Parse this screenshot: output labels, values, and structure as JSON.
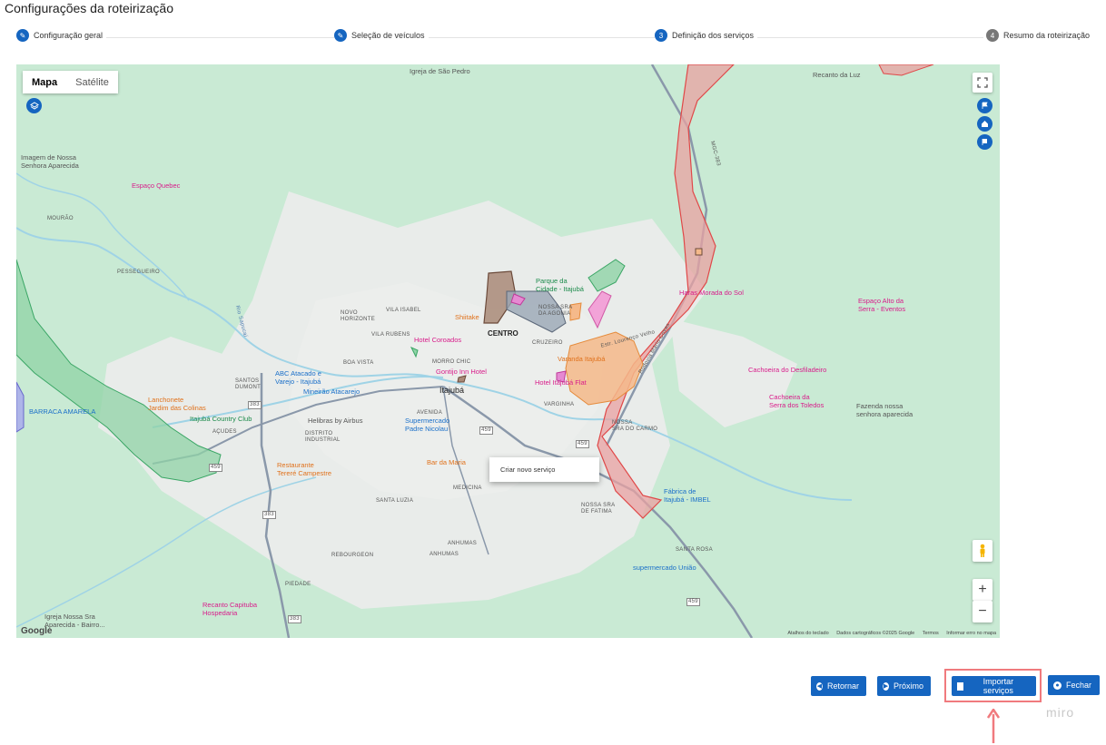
{
  "page": {
    "title": "Configurações da roteirização"
  },
  "stepper": {
    "steps": [
      {
        "number": "",
        "label": "Configuração geral",
        "state": "done"
      },
      {
        "number": "",
        "label": "Seleção de veículos",
        "state": "done"
      },
      {
        "number": "3",
        "label": "Definição dos serviços",
        "state": "active"
      },
      {
        "number": "4",
        "label": "Resumo da roteirização",
        "state": "pending"
      }
    ]
  },
  "map": {
    "type_toggle": {
      "map": "Mapa",
      "satellite": "Satélite",
      "selected": "Mapa"
    },
    "controls": {
      "fullscreen_icon": "fullscreen-icon",
      "zoom_in": "+",
      "zoom_out": "−",
      "street_view_icon": "pegman-icon"
    },
    "places": {
      "igreja_sao_pedro": "Igreja de São Pedro",
      "recanto_luz": "Recanto da Luz",
      "imagem_nossa_senhora": "Imagem de Nossa\nSenhora Aparecida",
      "espaco_quebec": "Espaço Quebec",
      "mourao": "MOURÃO",
      "pessegueiro": "PESSEGUEIRO",
      "parque_cidade": "Parque da\nCidade - Itajubá",
      "haras": "Haras Morada do Sol",
      "espaco_alto": "Espaço Alto da\nSerra - Eventos",
      "novo_horizonte": "NOVO\nHORIZONTE",
      "vila_isabel": "VILA ISABEL",
      "shiitake": "Shiitake",
      "nossa_sra_agonia": "NOSSA SRA\nDA AGONIA",
      "vila_rubens": "VILA RUBENS",
      "centro": "CENTRO",
      "cruzeiro": "CRUZEIRO",
      "hotel_coroados": "Hotel Coroados",
      "varanda": "Varanda Itajubá",
      "cachoeira_desfiladeiro": "Cachoeira do Desfiladeiro",
      "boa_vista": "BOA VISTA",
      "morro_chic": "MORRO CHIC",
      "gontijo": "Gontijo Inn Hotel",
      "hotel_flat": "Hotel Itajubá Flat",
      "santos_dumont": "SANTOS\nDUMONT",
      "abc_atacado": "ABC Atacado e\nVarejo - Itajubá",
      "mineirao": "Mineirão Atacarejo",
      "itajuba": "Itajubá",
      "varginha": "VARGINHA",
      "cachoeira_toledos": "Cachoeira da\nSerra dos Toledos",
      "fazenda": "Fazenda nossa\nsenhora aparecida",
      "lanchonete": "Lanchonete\nJardim das Colinas",
      "barraca": "BARRACA AMARELA",
      "country_club": "Itajubá Country Club",
      "helibras": "Helibras by Airbus",
      "avenida": "AVENIDA",
      "supermercado_nicolau": "Supermercado\nPadre Nicolau",
      "nossa_sra_carmo": "NOSSA\nSRA DO CARMO",
      "acudes": "AÇUDES",
      "distrito": "DISTRITO\nINDUSTRIAL",
      "restaurante": "Restaurante\nTereré Campestre",
      "bar_maria": "Bar da Maria",
      "fabrica": "Fábrica de\nItajubá - IMBEL",
      "santa_luzia": "SANTA LUZIA",
      "medicina": "MEDICINA",
      "nossa_sra_fatima": "NOSSA SRA\nDE FATIMA",
      "anhumas": "ANHUMAS",
      "rebourgeon": "REBOURGEON",
      "anhumas2": "ANHUMAS",
      "santa_rosa": "SANTA ROSA",
      "supermercado_uniao": "supermercado União",
      "piedade": "PIEDADE",
      "recanto_capituba": "Recanto Capituba\nHospedaria",
      "igreja_aparecida": "Igreja Nossa Sra\nAparecida - Bairro...",
      "rio_sapucai": "Rio Sapucaí",
      "rodovia": "Rodovia Mário Covas",
      "mgc383": "MGC-383",
      "estr_lourenco": "Estr. Lourenço Velho"
    },
    "road_shields": [
      "383",
      "459",
      "459",
      "459",
      "459",
      "383",
      "383"
    ],
    "context_menu": {
      "item": "Criar novo serviço"
    },
    "attribution": {
      "shortcuts": "Atalhos do teclado",
      "data": "Dados cartográficos ©2025 Google",
      "terms": "Termos",
      "report": "Informar erro no mapa",
      "logo": "Google"
    },
    "colors": {
      "land": "#e8ece6",
      "vegetation": "#c9ead4",
      "water": "#9fd3e6",
      "zone_red": "#e8a2a2",
      "zone_orange": "#f5b98a",
      "zone_green": "#8fd3a6"
    }
  },
  "actions": {
    "back": "Retornar",
    "next": "Próximo",
    "import": "Importar serviços",
    "close": "Fechar"
  },
  "watermark": "miro"
}
